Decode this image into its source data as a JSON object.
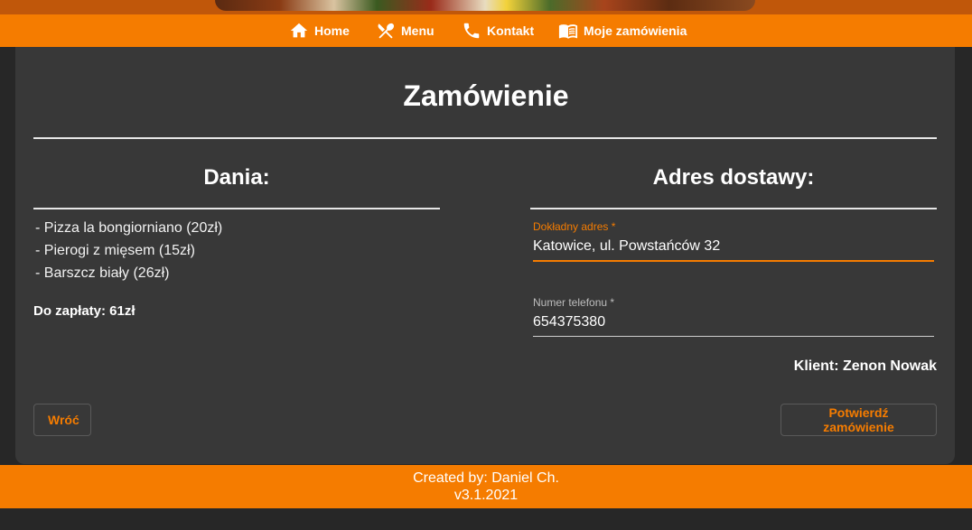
{
  "nav": {
    "items": [
      {
        "label": "Home",
        "icon": "home-icon"
      },
      {
        "label": "Menu",
        "icon": "cutlery-icon"
      },
      {
        "label": "Kontakt",
        "icon": "phone-icon"
      },
      {
        "label": "Moje zamówienia",
        "icon": "menu-book-icon"
      }
    ]
  },
  "order": {
    "title": "Zamówienie",
    "dishes_heading": "Dania:",
    "dishes": [
      "- Pizza la bongiorniano (20zł)",
      "- Pierogi z mięsem (15zł)",
      "- Barszcz biały (26zł)"
    ],
    "total": "Do zapłaty: 61zł",
    "address_heading": "Adres dostawy:",
    "address_field": {
      "label": "Dokładny adres *",
      "value": "Katowice, ul. Powstańców 32"
    },
    "phone_field": {
      "label": "Numer telefonu *",
      "value": "654375380"
    },
    "client": "Klient: Zenon Nowak",
    "back_button": "Wróć",
    "confirm_button": "Potwierdź zamówienie"
  },
  "footer": {
    "created_by": "Created by: Daniel Ch.",
    "version": "v3.1.2021"
  },
  "colors": {
    "accent": "#f57c00",
    "background": "#272727",
    "card": "#383838"
  }
}
